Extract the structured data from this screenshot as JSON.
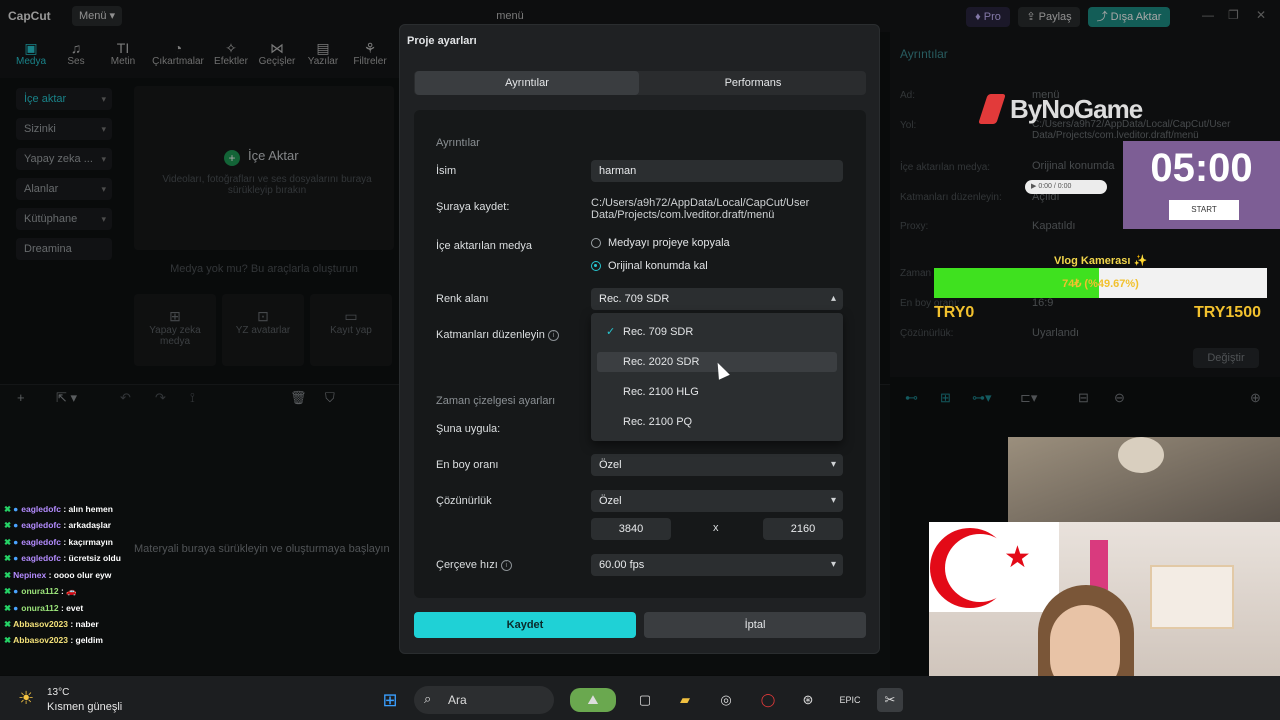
{
  "app": {
    "name": "CapCut",
    "menu_label": "Menü",
    "window_title": "menü",
    "pro_label": "Pro",
    "share_label": "Paylaş",
    "export_label": "Dışa Aktar"
  },
  "toolbar": {
    "items": [
      {
        "label": "Medya",
        "icon": "media-icon"
      },
      {
        "label": "Ses",
        "icon": "audio-icon"
      },
      {
        "label": "Metin",
        "icon": "text-icon"
      },
      {
        "label": "Çıkartmalar",
        "icon": "sticker-icon"
      },
      {
        "label": "Efektler",
        "icon": "effects-icon"
      },
      {
        "label": "Geçişler",
        "icon": "transitions-icon"
      },
      {
        "label": "Yazılar",
        "icon": "captions-icon"
      },
      {
        "label": "Filtreler",
        "icon": "filters-icon"
      }
    ]
  },
  "sidebar": {
    "items": [
      {
        "label": "İçe aktar"
      },
      {
        "label": "Sizinki"
      },
      {
        "label": "Yapay zeka ..."
      },
      {
        "label": "Alanlar"
      },
      {
        "label": "Kütüphane"
      },
      {
        "label": "Dreamina"
      }
    ]
  },
  "media": {
    "import_label": "İçe Aktar",
    "hint": "Videoları, fotoğrafları ve ses dosyalarını buraya sürükleyip bırakın",
    "no_media": "Medya yok mu? Bu araçlarla oluşturun",
    "tools": [
      {
        "label": "Yapay zeka medya"
      },
      {
        "label": "YZ avatarlar"
      },
      {
        "label": "Kayıt yap"
      }
    ]
  },
  "timeline": {
    "drop_hint": "Materyali buraya sürükleyin ve oluşturmaya başlayın"
  },
  "details_panel": {
    "title": "Ayrıntılar",
    "rows": [
      {
        "label": "Ad:",
        "value": "menü"
      },
      {
        "label": "Yol:",
        "value": "C:/Users/a9h72/AppData/Local/CapCut/User Data/Projects/com.lveditor.draft/menü"
      },
      {
        "label": "İçe aktarılan medya:",
        "value": "Orijinal konumda"
      },
      {
        "label": "Katmanları düzenleyin:",
        "value": "Açıldı"
      },
      {
        "label": "Proxy:",
        "value": "Kapatıldı"
      },
      {
        "label": "Zaman çizelgesi:",
        "value": ""
      },
      {
        "label": "En boy oranı:",
        "value": "16:9"
      },
      {
        "label": "Çözünürlük:",
        "value": "Uyarlandı"
      }
    ],
    "change_label": "Değiştir"
  },
  "dialog": {
    "title": "Proje ayarları",
    "tabs": [
      "Ayrıntılar",
      "Performans"
    ],
    "section_details": "Ayrıntılar",
    "name_label": "İsim",
    "name_value": "harman",
    "save_to_label": "Şuraya kaydet:",
    "save_to_value": "C:/Users/a9h72/AppData/Local/CapCut/User Data/Projects/com.lveditor.draft/menü",
    "imported_media_label": "İçe aktarılan medya",
    "radio_copy": "Medyayı projeye kopyala",
    "radio_original": "Orijinal konumda kal",
    "color_space_label": "Renk alanı",
    "color_space_value": "Rec. 709 SDR",
    "layers_label": "Katmanları düzenleyin",
    "color_options": [
      "Rec. 709 SDR",
      "Rec. 2020 SDR",
      "Rec. 2100 HLG",
      "Rec. 2100 PQ"
    ],
    "selected_option": "Rec. 709 SDR",
    "hovered_option": "Rec. 2020 SDR",
    "section_timeline": "Zaman çizelgesi ayarları",
    "apply_to_label": "Şuna uygula:",
    "aspect_label": "En boy oranı",
    "aspect_value": "Özel",
    "resolution_label": "Çözünürlük",
    "resolution_value": "Özel",
    "width": "3840",
    "height": "2160",
    "times": "x",
    "framerate_label": "Çerçeve hızı",
    "framerate_value": "60.00 fps",
    "save_label": "Kaydet",
    "cancel_label": "İptal"
  },
  "chat": [
    {
      "user": "eagledofc",
      "text": ": alın hemen",
      "color": "#b48cff"
    },
    {
      "user": "eagledofc",
      "text": ": arkadaşlar",
      "color": "#b48cff"
    },
    {
      "user": "eagledofc",
      "text": ": kaçırmayın",
      "color": "#b48cff"
    },
    {
      "user": "eagledofc",
      "text": ": ücretsiz oldu",
      "color": "#b48cff"
    },
    {
      "user": "Nepinex",
      "text": ": oooo olur eyw",
      "color": "#b48cff"
    },
    {
      "user": "onura112",
      "text": ": 🚗",
      "color": "#9be37a"
    },
    {
      "user": "onura112",
      "text": ": evet",
      "color": "#9be37a"
    },
    {
      "user": "Abbasov2023",
      "text": ": naber",
      "color": "#f4e27a"
    },
    {
      "user": "Abbasov2023",
      "text": ": geldim",
      "color": "#f4e27a"
    }
  ],
  "taskbar": {
    "temp": "13°C",
    "weather": "Kısmen güneşli",
    "search": "Ara"
  },
  "overlay": {
    "brand": "ByNoGame",
    "timer": "05:00",
    "start": "START",
    "camera_label": "Vlog Kamerası ✨",
    "progress_text": "74₺ (%49.67%)",
    "progress_fraction": 0.4967,
    "try_left": "TRY0",
    "try_right": "TRY1500",
    "player_label": "0:00 / 0:00"
  }
}
